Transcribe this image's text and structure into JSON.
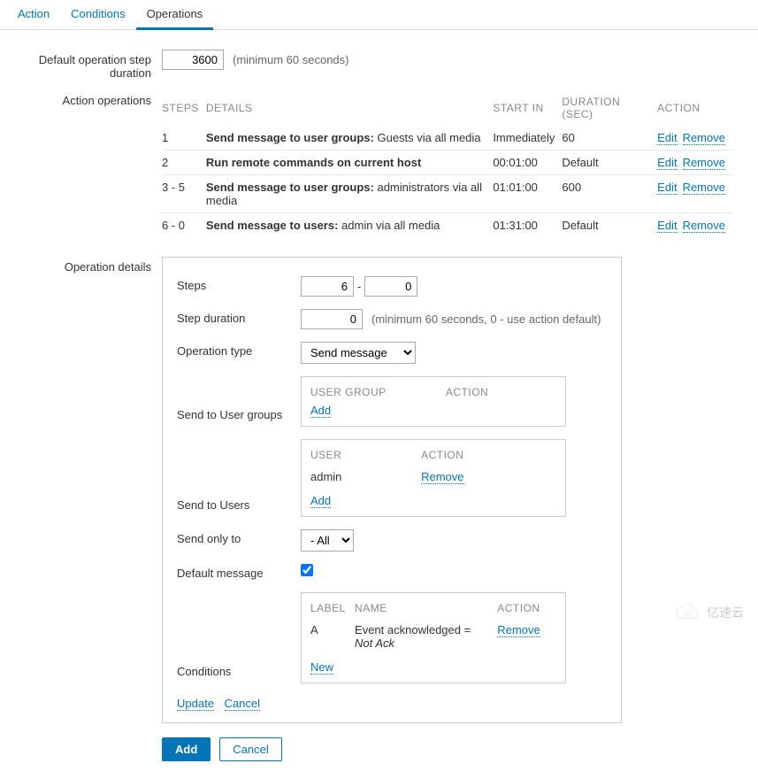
{
  "tabs": {
    "action": "Action",
    "conditions": "Conditions",
    "operations": "Operations"
  },
  "defaultStep": {
    "label": "Default operation step duration",
    "value": "3600",
    "hint": "(minimum 60 seconds)"
  },
  "actionOps": {
    "label": "Action operations",
    "headers": {
      "steps": "STEPS",
      "details": "DETAILS",
      "startin": "START IN",
      "duration": "DURATION (SEC)",
      "action": "ACTION"
    },
    "rows": [
      {
        "steps": "1",
        "details_b": "Send message to user groups:",
        "details_r": " Guests via all media",
        "start": "Immediately",
        "dur": "60"
      },
      {
        "steps": "2",
        "details_b": "Run remote commands on current host",
        "details_r": "",
        "start": "00:01:00",
        "dur": "Default"
      },
      {
        "steps": "3 - 5",
        "details_b": "Send message to user groups:",
        "details_r": " administrators via all media",
        "start": "01:01:00",
        "dur": "600"
      },
      {
        "steps": "6 - 0",
        "details_b": "Send message to users:",
        "details_r": " admin via all media",
        "start": "01:31:00",
        "dur": "Default"
      }
    ],
    "edit": "Edit",
    "remove": "Remove"
  },
  "details": {
    "label": "Operation details",
    "steps": {
      "label": "Steps",
      "from": "6",
      "to": "0"
    },
    "stepdur": {
      "label": "Step duration",
      "value": "0",
      "hint": "(minimum 60 seconds, 0 - use action default)"
    },
    "optype": {
      "label": "Operation type",
      "value": "Send message"
    },
    "ugroups": {
      "label": "Send to User groups",
      "h1": "USER GROUP",
      "h2": "ACTION",
      "add": "Add"
    },
    "users": {
      "label": "Send to Users",
      "h1": "USER",
      "h2": "ACTION",
      "user": "admin",
      "remove": "Remove",
      "add": "Add"
    },
    "sendonly": {
      "label": "Send only to",
      "value": "- All -"
    },
    "defaultmsg": {
      "label": "Default message"
    },
    "conditions": {
      "label": "Conditions",
      "h1": "LABEL",
      "h2": "NAME",
      "h3": "ACTION",
      "clabel": "A",
      "cname_a": "Event acknowledged = ",
      "cname_b": "Not Ack",
      "remove": "Remove",
      "new": "New"
    },
    "update": "Update",
    "cancel": "Cancel"
  },
  "buttons": {
    "add": "Add",
    "cancel": "Cancel"
  },
  "watermark": "亿速云"
}
